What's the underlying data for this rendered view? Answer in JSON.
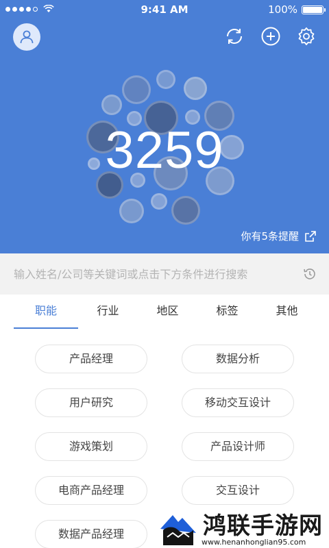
{
  "status_bar": {
    "time": "9:41 AM",
    "battery": "100%"
  },
  "header": {
    "icons": {
      "avatar": "user-icon",
      "refresh": "refresh-icon",
      "add": "plus-icon",
      "settings": "gear-icon"
    },
    "count": "3259",
    "reminder": "你有5条提醒"
  },
  "search": {
    "placeholder": "输入姓名/公司等关键词或点击下方条件进行搜索"
  },
  "tabs": [
    {
      "label": "职能",
      "active": true
    },
    {
      "label": "行业",
      "active": false
    },
    {
      "label": "地区",
      "active": false
    },
    {
      "label": "标签",
      "active": false
    },
    {
      "label": "其他",
      "active": false
    }
  ],
  "options": [
    "产品经理",
    "数据分析",
    "用户研究",
    "移动交互设计",
    "游戏策划",
    "产品设计师",
    "电商产品经理",
    "交互设计",
    "数据产品经理"
  ],
  "watermark": {
    "title": "鸿联手游网",
    "url": "www.henanhonglian95.com"
  },
  "colors": {
    "primary": "#4a7fd6",
    "search_bg": "#f2f2f2"
  }
}
